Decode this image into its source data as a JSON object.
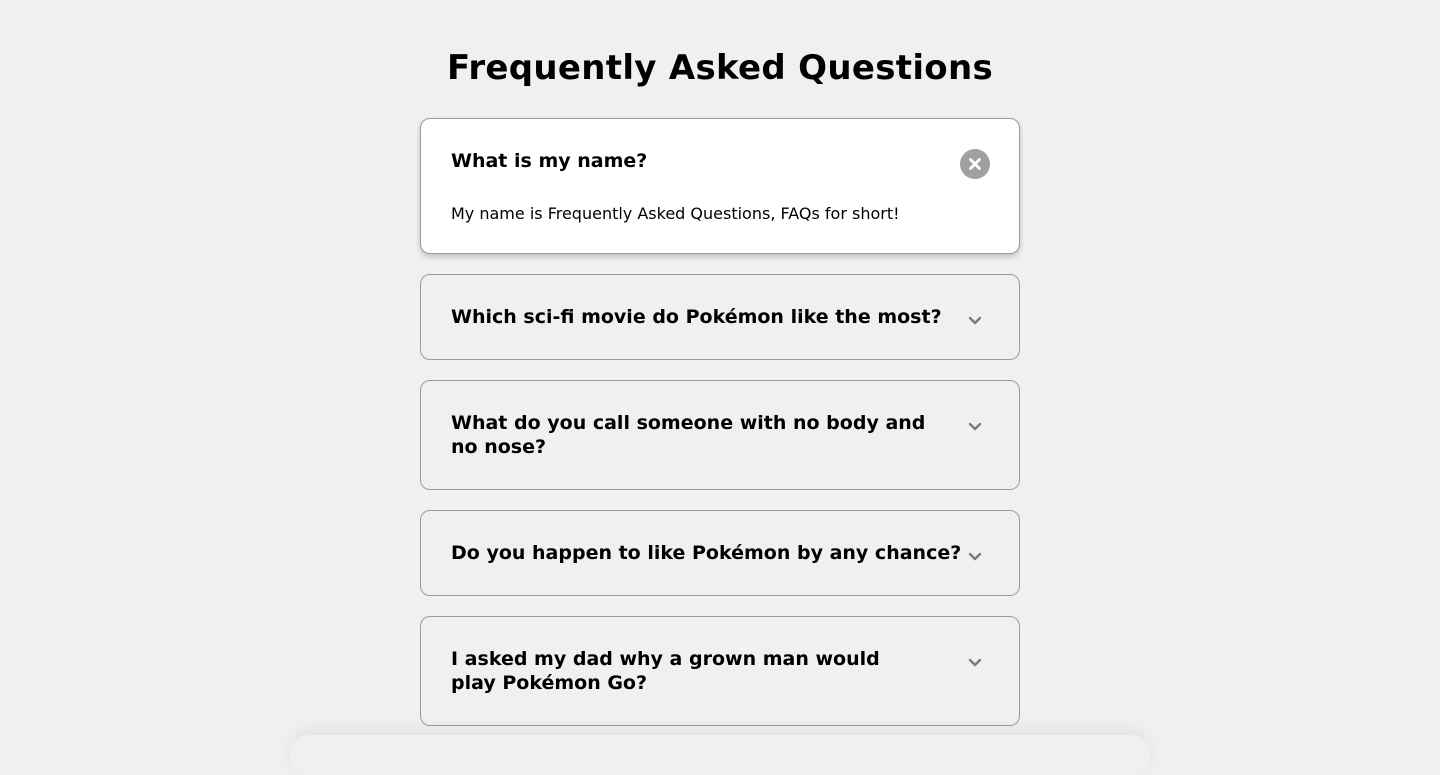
{
  "page": {
    "title": "Frequently Asked Questions"
  },
  "faqs": [
    {
      "question": "What is my name?",
      "answer": "My name is Frequently Asked Questions, FAQs for short!",
      "expanded": true,
      "toggle_icon": "close-icon"
    },
    {
      "question": "Which sci-fi movie do Pokémon like the most?",
      "expanded": false,
      "toggle_icon": "chevron-down-icon"
    },
    {
      "question": "What do you call someone with no body and no nose?",
      "expanded": false,
      "toggle_icon": "chevron-down-icon"
    },
    {
      "question": "Do you happen to like Pokémon by any chance?",
      "expanded": false,
      "toggle_icon": "chevron-down-icon"
    },
    {
      "question": "I asked my dad why a grown man would play Pokémon Go?",
      "expanded": false,
      "toggle_icon": "chevron-down-icon"
    }
  ],
  "colors": {
    "background": "#f0f0f0",
    "active_card": "#ffffff",
    "border": "#9b9b9b",
    "icon": "#7a7a7a",
    "close_button": "#9fa0a1"
  }
}
